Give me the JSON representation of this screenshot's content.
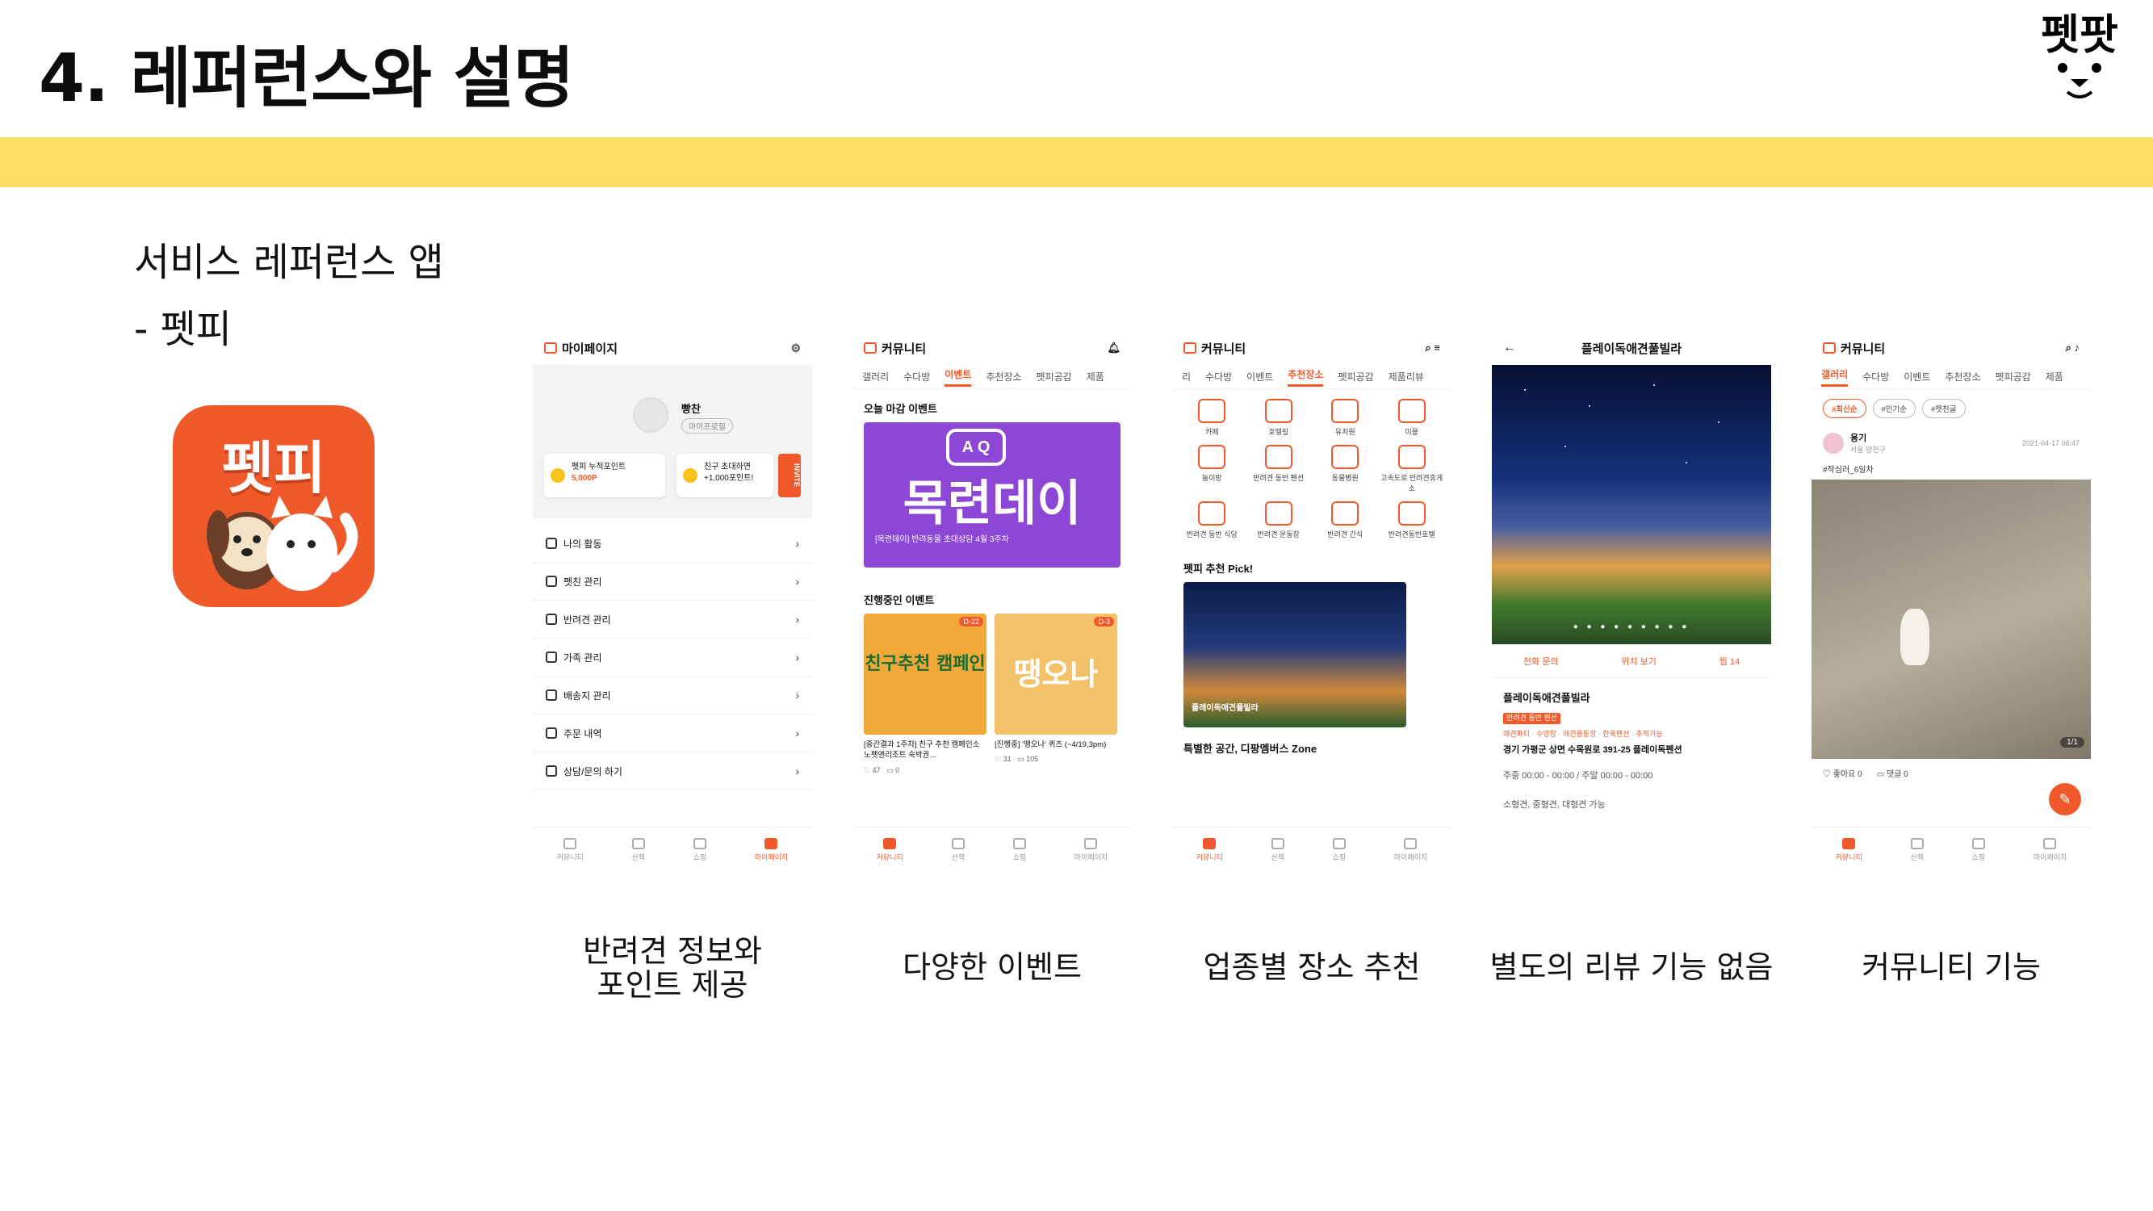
{
  "slide": {
    "title": "4. 레퍼런스와 설명",
    "logo_text": "펫팟"
  },
  "section": {
    "title": "서비스 레퍼런스 앱",
    "subtitle": "- 펫피",
    "app_icon_text": "펫피"
  },
  "colors": {
    "band": "#ffe066",
    "accent": "#f05a2a",
    "event_banner": "#8d47d6"
  },
  "screens": [
    {
      "header": "마이페이지",
      "profile_name": "빵찬",
      "profile_badge": "마이프로필",
      "point_card_1": {
        "label": "펫피 누적포인트",
        "value": "5,000P"
      },
      "point_card_2": {
        "label": "친구 초대하면",
        "value": "+1,000포인트!"
      },
      "invite": "INVITE",
      "menu": [
        {
          "label": "나의 활동",
          "icon": "person-icon"
        },
        {
          "label": "펫친 관리",
          "icon": "group-icon"
        },
        {
          "label": "반려견 관리",
          "icon": "paw-icon"
        },
        {
          "label": "가족 관리",
          "icon": "house-icon"
        },
        {
          "label": "배송지 관리",
          "icon": "address-icon"
        },
        {
          "label": "주문 내역",
          "icon": "bag-icon"
        },
        {
          "label": "상담/문의 하기",
          "icon": "chat-icon"
        }
      ],
      "nav": [
        "커뮤니티",
        "산책",
        "쇼핑",
        "마이페이지"
      ],
      "nav_active": 3
    },
    {
      "header": "커뮤니티",
      "tabs": [
        "갤러리",
        "수다방",
        "이벤트",
        "추천장소",
        "펫피공감",
        "제품"
      ],
      "tab_active": 2,
      "block1_title": "오늘 마감 이벤트",
      "banner_bubble": "A Q",
      "banner_big": "목련데이",
      "banner_sub": "[목련데이] 반려동물 초대상담 4월 3주차",
      "block2_title": "진행중인 이벤트",
      "events": [
        {
          "tag": "D-22",
          "label": "친구추천 캠페인",
          "text": "[중간결과 1주차] 친구 추천 캠페인소노펫앤리조트 숙박권…",
          "likes": "47",
          "comments": "0",
          "color": "#f0a837"
        },
        {
          "tag": "D-3",
          "label": "땡오나",
          "text": "[진행중] '땡오나' 퀴즈 (~4/19,3pm)",
          "likes": "31",
          "comments": "105",
          "color": "#f3c168"
        }
      ],
      "nav": [
        "커뮤니티",
        "산책",
        "쇼핑",
        "마이페이지"
      ],
      "nav_active": 0
    },
    {
      "header": "커뮤니티",
      "tabs": [
        "리",
        "수다방",
        "이벤트",
        "추천장소",
        "펫피공감",
        "제품리뷰"
      ],
      "tab_active": 3,
      "categories": [
        "카페",
        "호텔링",
        "유치원",
        "미용",
        "놀이방",
        "반려견 동반 펜션",
        "동물병원",
        "고속도로 반려견휴게소",
        "반려견 동반 식당",
        "반려견 운동장",
        "반려견 간식",
        "반려견동반호텔"
      ],
      "pick_title": "펫피 추천 Pick!",
      "pick_caption": "플레이독애견풀빌라",
      "special_title": "특별한 공간, 디팡멤버스 Zone",
      "nav": [
        "커뮤니티",
        "산책",
        "쇼핑",
        "마이페이지"
      ],
      "nav_active": 0
    },
    {
      "header": "플레이독애견풀빌라",
      "back": "←",
      "actions": [
        "전화 문의",
        "위치 보기",
        "찜 14"
      ],
      "name": "플레이독애견풀빌라",
      "tag": "반려견 동반 펜션",
      "keywords": "애견파티 · 수영장 · 애견용동장 · 한옥펜션 · 추적기능",
      "address": "경기 가평군 상면 수목원로 391-25 플레이독펜션",
      "hours": "주중 00:00 - 00:00 / 주말 00:00 - 00:00",
      "pets": "소형견, 중형견, 대형견 가능"
    },
    {
      "header": "커뮤니티",
      "tabs": [
        "갤러리",
        "수다방",
        "이벤트",
        "추천장소",
        "펫피공감",
        "제품"
      ],
      "tab_active": 0,
      "chips": [
        "#최신순",
        "#인기순",
        "#펫친글"
      ],
      "user": "용기",
      "location": "서울 양천구",
      "date": "2021-04-17 06:47",
      "post_tag": "#작심러_6일차",
      "image_count": "1/1",
      "likes": "좋아요 0",
      "comments": "댓글 0",
      "nav": [
        "커뮤니티",
        "산책",
        "쇼핑",
        "마이페이지"
      ],
      "nav_active": 0
    }
  ],
  "captions": [
    "반려견 정보와\n포인트 제공",
    "다양한 이벤트",
    "업종별 장소 추천",
    "별도의 리뷰 기능 없음",
    "커뮤니티 기능"
  ]
}
